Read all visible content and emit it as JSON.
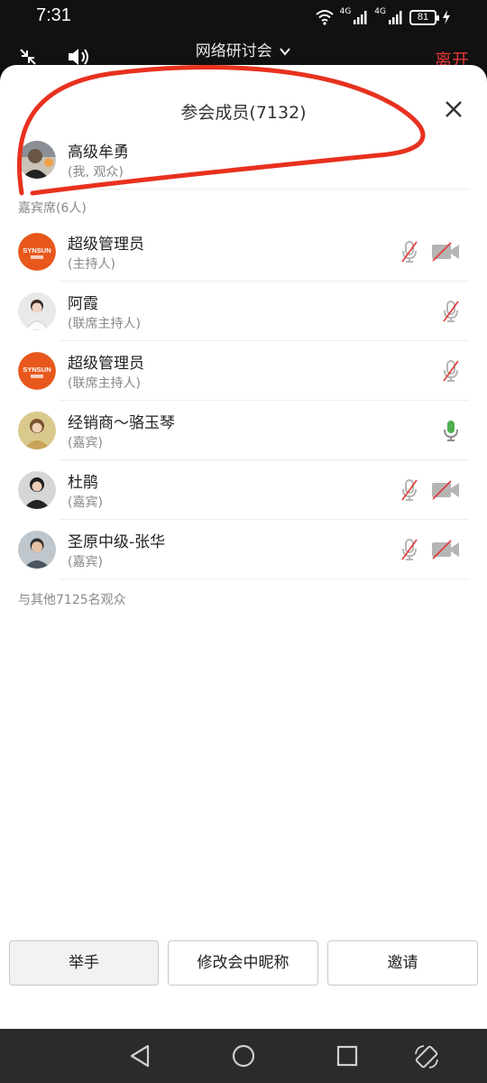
{
  "status": {
    "time": "7:31",
    "net1": "4G",
    "net2": "4G",
    "battery": "81"
  },
  "meeting": {
    "title": "网络研讨会",
    "leave_label": "离开"
  },
  "panel": {
    "title": "参会成员(7132)",
    "self": {
      "name": "高级牟勇",
      "role": "(我, 观众)"
    },
    "guest_section_label": "嘉宾席(6人)",
    "members": [
      {
        "name": "超级管理员",
        "role": "(主持人)",
        "avatar": "synsun",
        "mic": "muted",
        "camera": "off"
      },
      {
        "name": "阿霞",
        "role": "(联席主持人)",
        "avatar": "person",
        "mic": "muted",
        "camera": "none"
      },
      {
        "name": "超级管理员",
        "role": "(联席主持人)",
        "avatar": "synsun",
        "mic": "muted",
        "camera": "none"
      },
      {
        "name": "经销商～骆玉琴",
        "role": "(嘉宾)",
        "avatar": "person",
        "mic": "active",
        "camera": "none"
      },
      {
        "name": "杜鹃",
        "role": "(嘉宾)",
        "avatar": "person",
        "mic": "muted",
        "camera": "off"
      },
      {
        "name": "圣原中级-张华",
        "role": "(嘉宾)",
        "avatar": "person",
        "mic": "muted",
        "camera": "off"
      }
    ],
    "audience_summary": "与其他7125名观众",
    "logo_text": "SYNSUN"
  },
  "actions": {
    "raise_hand": "举手",
    "rename": "修改会中昵称",
    "invite": "邀请"
  },
  "colors": {
    "accent_red": "#e53935",
    "mic_active": "#4caf50",
    "muted_gray": "#b5b5b5",
    "logo_orange": "#e8581c"
  },
  "icons": [
    "shrink-icon",
    "speaker-icon",
    "chevron-down-icon",
    "close-icon",
    "mic-muted-icon",
    "camera-off-icon",
    "mic-active-icon",
    "back-icon",
    "home-icon",
    "recents-icon",
    "rotate-icon"
  ]
}
